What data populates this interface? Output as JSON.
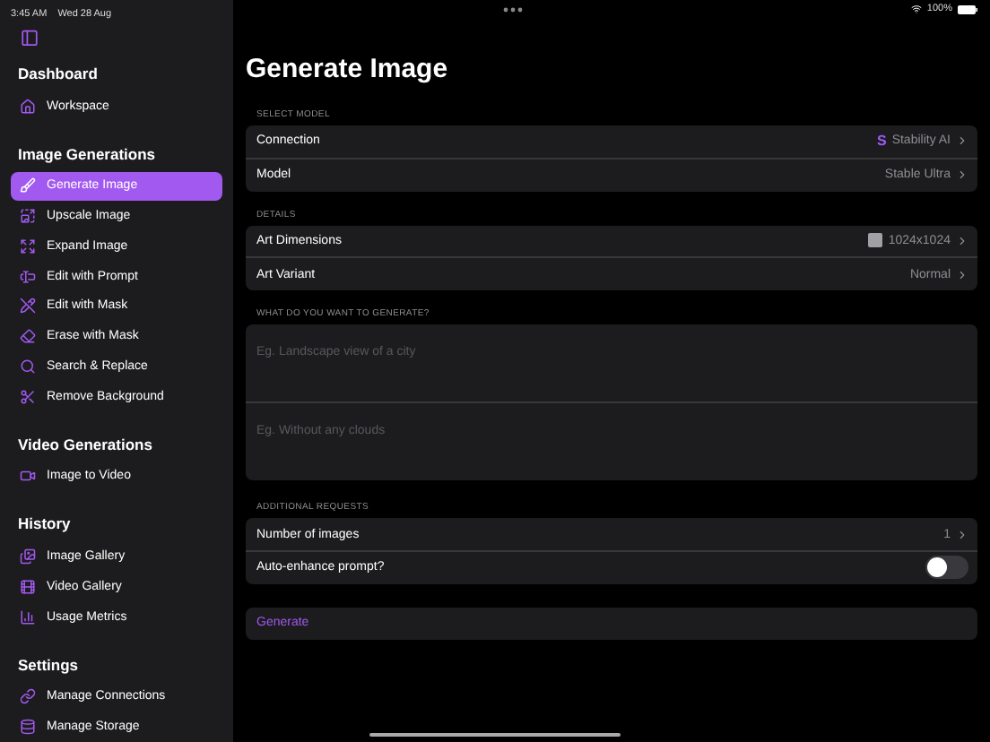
{
  "status_bar": {
    "time": "3:45 AM",
    "date": "Wed 28 Aug",
    "battery": "100%"
  },
  "sidebar": {
    "sections": [
      {
        "title": "Dashboard",
        "items": [
          {
            "label": "Workspace",
            "selected": false
          }
        ]
      },
      {
        "title": "Image Generations",
        "items": [
          {
            "label": "Generate Image",
            "selected": true
          },
          {
            "label": "Upscale Image",
            "selected": false
          },
          {
            "label": "Expand Image",
            "selected": false
          },
          {
            "label": "Edit with Prompt",
            "selected": false
          },
          {
            "label": "Edit with Mask",
            "selected": false
          },
          {
            "label": "Erase with Mask",
            "selected": false
          },
          {
            "label": "Search & Replace",
            "selected": false
          },
          {
            "label": "Remove Background",
            "selected": false
          }
        ]
      },
      {
        "title": "Video Generations",
        "items": [
          {
            "label": "Image to Video",
            "selected": false
          }
        ]
      },
      {
        "title": "History",
        "items": [
          {
            "label": "Image Gallery",
            "selected": false
          },
          {
            "label": "Video Gallery",
            "selected": false
          },
          {
            "label": "Usage Metrics",
            "selected": false
          }
        ]
      },
      {
        "title": "Settings",
        "items": [
          {
            "label": "Manage Connections",
            "selected": false
          },
          {
            "label": "Manage Storage",
            "selected": false
          }
        ]
      }
    ]
  },
  "main": {
    "title": "Generate Image",
    "groups": [
      {
        "header": "SELECT MODEL",
        "rows": [
          {
            "kind": "logo",
            "label": "Connection",
            "logo": "S",
            "value": "Stability AI"
          },
          {
            "kind": "value",
            "label": "Model",
            "value": "Stable Ultra"
          }
        ]
      },
      {
        "header": "DETAILS",
        "rows": [
          {
            "kind": "swatch",
            "label": "Art Dimensions",
            "value": "1024x1024"
          },
          {
            "kind": "value",
            "label": "Art Variant",
            "value": "Normal"
          }
        ]
      },
      {
        "header": "WHAT DO YOU WANT TO GENERATE?",
        "rows": [
          {
            "kind": "text",
            "placeholder": "Eg. Landscape view of a city"
          },
          {
            "kind": "text",
            "placeholder": "Eg. Without any clouds"
          }
        ]
      },
      {
        "header": "ADDITIONAL REQUESTS",
        "rows": [
          {
            "kind": "value",
            "label": "Number of images",
            "value": "1"
          },
          {
            "kind": "toggle",
            "label": "Auto-enhance prompt?",
            "on": false
          }
        ]
      }
    ],
    "action": "Generate"
  }
}
